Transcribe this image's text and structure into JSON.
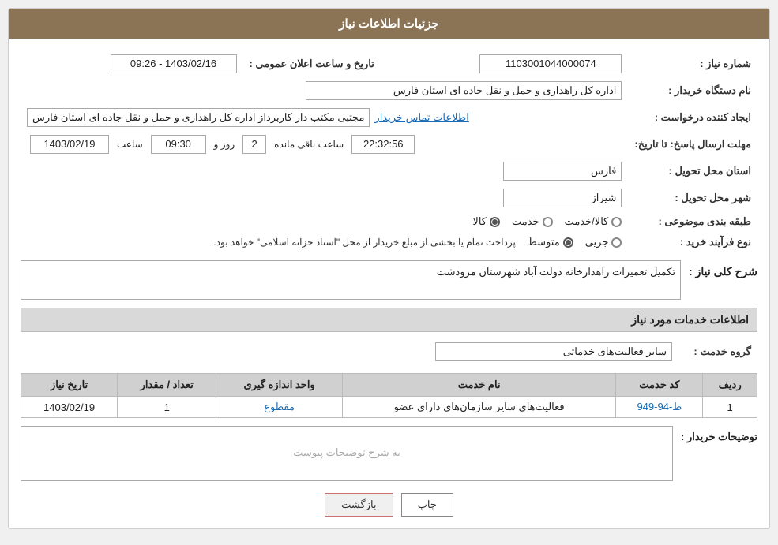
{
  "header": {
    "title": "جزئیات اطلاعات نیاز"
  },
  "fields": {
    "request_number_label": "شماره نیاز :",
    "request_number_value": "1103001044000074",
    "buyer_org_label": "نام دستگاه خریدار :",
    "buyer_org_value": "اداره کل راهداری و حمل و نقل جاده ای استان فارس",
    "creator_label": "ایجاد کننده درخواست :",
    "creator_value": "مجتبی مکتب دار کاربرداز اداره کل راهداری و حمل و نقل جاده ای استان فارس",
    "contact_link": "اطلاعات تماس خریدار",
    "announce_date_label": "تاریخ و ساعت اعلان عمومی :",
    "announce_date_value": "1403/02/16 - 09:26",
    "reply_deadline_label": "مهلت ارسال پاسخ: تا تاریخ:",
    "reply_date": "1403/02/19",
    "reply_time_label": "ساعت",
    "reply_time": "09:30",
    "reply_days_label": "روز و",
    "reply_days": "2",
    "reply_remaining_label": "ساعت باقی مانده",
    "reply_remaining": "22:32:56",
    "province_label": "استان محل تحویل :",
    "province_value": "فارس",
    "city_label": "شهر محل تحویل :",
    "city_value": "شیراز",
    "category_label": "طبقه بندی موضوعی :",
    "category_options": [
      {
        "label": "کالا",
        "selected": true
      },
      {
        "label": "خدمت",
        "selected": false
      },
      {
        "label": "کالا/خدمت",
        "selected": false
      }
    ],
    "purchase_type_label": "نوع فرآیند خرید :",
    "purchase_type_options": [
      {
        "label": "جزیی",
        "selected": false
      },
      {
        "label": "متوسط",
        "selected": true
      }
    ],
    "purchase_note": "پرداخت تمام یا بخشی از مبلغ خریدار از محل \"اسناد خزانه اسلامی\" خواهد بود.",
    "description_label": "شرح کلی نیاز :",
    "description_value": "تکمیل تعمیرات راهدارخانه دولت آباد شهرستان مرودشت"
  },
  "services_section": {
    "title": "اطلاعات خدمات مورد نیاز",
    "service_group_label": "گروه خدمت :",
    "service_group_value": "سایر فعالیت‌های خدماتی",
    "table": {
      "columns": [
        "ردیف",
        "کد خدمت",
        "نام خدمت",
        "واحد اندازه گیری",
        "تعداد / مقدار",
        "تاریخ نیاز"
      ],
      "rows": [
        {
          "row_num": "1",
          "service_code": "ط-94-949",
          "service_name": "فعالیت‌های سایر سازمان‌های دارای عضو",
          "unit": "مقطوع",
          "quantity": "1",
          "date": "1403/02/19"
        }
      ]
    }
  },
  "buyer_desc_label": "توضیحات خریدار :",
  "buyer_desc_placeholder": "به شرح توضیحات پیوست",
  "buttons": {
    "print": "چاپ",
    "back": "بازگشت"
  }
}
